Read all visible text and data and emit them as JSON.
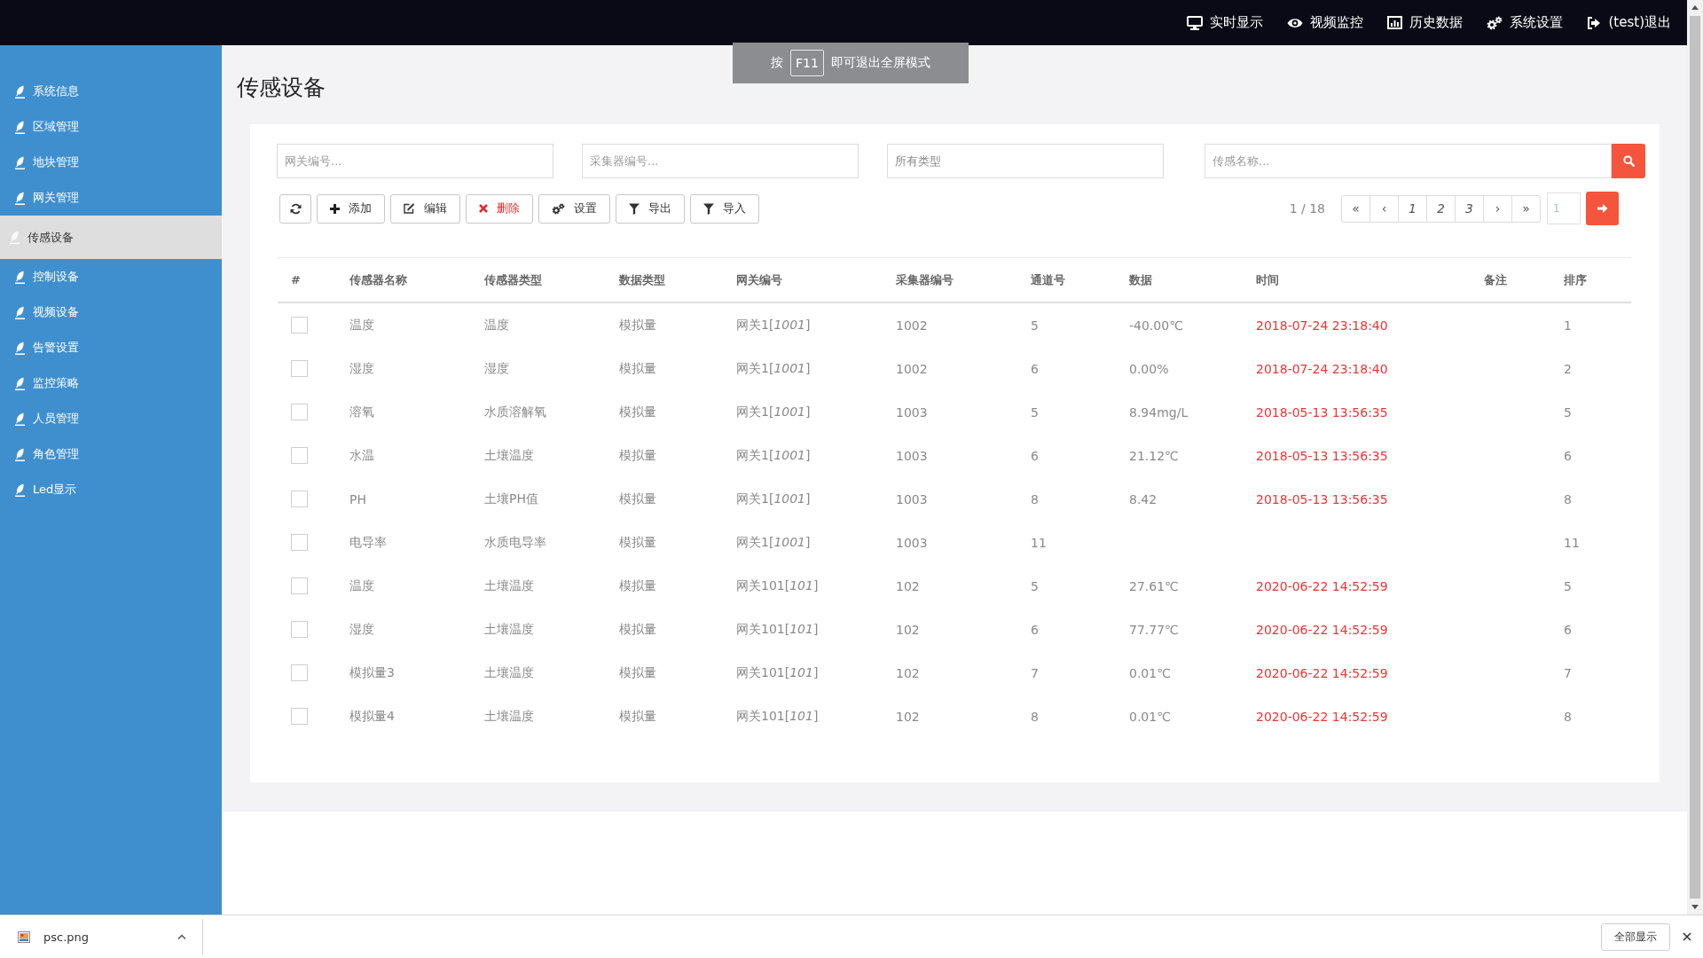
{
  "top_nav": {
    "items": [
      {
        "label": "实时显示"
      },
      {
        "label": "视频监控"
      },
      {
        "label": "历史数据"
      },
      {
        "label": "系统设置"
      },
      {
        "label": "(test)退出"
      }
    ]
  },
  "fullscreen_hint": {
    "before": "按",
    "key": "F11",
    "after": "即可退出全屏模式"
  },
  "sidebar": {
    "items": [
      {
        "label": "系统信息",
        "selected": false
      },
      {
        "label": "区域管理",
        "selected": false
      },
      {
        "label": "地块管理",
        "selected": false
      },
      {
        "label": "网关管理",
        "selected": false
      },
      {
        "label": "传感设备",
        "selected": true
      },
      {
        "label": "控制设备",
        "selected": false
      },
      {
        "label": "视频设备",
        "selected": false
      },
      {
        "label": "告警设置",
        "selected": false
      },
      {
        "label": "监控策略",
        "selected": false
      },
      {
        "label": "人员管理",
        "selected": false
      },
      {
        "label": "角色管理",
        "selected": false
      },
      {
        "label": "Led显示",
        "selected": false
      }
    ]
  },
  "page_title": "传感设备",
  "filters": [
    {
      "kind": "input",
      "placeholder": "网关编号..."
    },
    {
      "kind": "input",
      "placeholder": "采集器编号..."
    },
    {
      "kind": "select",
      "value": "所有类型"
    }
  ],
  "search": {
    "placeholder": "传感名称..."
  },
  "toolbar": {
    "buttons": [
      {
        "label": "添加",
        "kind": "default"
      },
      {
        "label": "编辑",
        "kind": "default"
      },
      {
        "label": "删除",
        "kind": "danger"
      },
      {
        "label": "设置",
        "kind": "default"
      },
      {
        "label": "导出",
        "kind": "default"
      },
      {
        "label": "导入",
        "kind": "default"
      }
    ]
  },
  "pagination": {
    "summary": "1 / 18",
    "buttons": [
      {
        "label": "«",
        "kind": "nav"
      },
      {
        "label": "‹",
        "kind": "nav"
      },
      {
        "label": "1",
        "kind": "page"
      },
      {
        "label": "2",
        "kind": "page"
      },
      {
        "label": "3",
        "kind": "page"
      },
      {
        "label": "›",
        "kind": "nav"
      },
      {
        "label": "»",
        "kind": "nav"
      }
    ],
    "page_input": {
      "placeholder": "1"
    }
  },
  "table": {
    "columns": [
      "#",
      "传感器名称",
      "传感器类型",
      "数据类型",
      "网关编号",
      "采集器编号",
      "通道号",
      "数据",
      "时间",
      "备注",
      "排序"
    ],
    "rows": [
      {
        "checked": false,
        "name": "温度",
        "sensor_type": "温度",
        "data_type": "模拟量",
        "gateway": "网关1[*1001*]",
        "collector": "1002",
        "channel": "5",
        "data": "-40.00℃",
        "time": "2018-07-24 23:18:40",
        "sort": "1"
      },
      {
        "checked": false,
        "name": "湿度",
        "sensor_type": "湿度",
        "data_type": "模拟量",
        "gateway": "网关1[*1001*]",
        "collector": "1002",
        "channel": "6",
        "data": "0.00%",
        "time": "2018-07-24 23:18:40",
        "sort": "2"
      },
      {
        "checked": false,
        "name": "溶氧",
        "sensor_type": "水质溶解氧",
        "data_type": "模拟量",
        "gateway": "网关1[*1001*]",
        "collector": "1003",
        "channel": "5",
        "data": "8.94mg/L",
        "time": "2018-05-13 13:56:35",
        "sort": "5"
      },
      {
        "checked": false,
        "name": "水温",
        "sensor_type": "土壤温度",
        "data_type": "模拟量",
        "gateway": "网关1[*1001*]",
        "collector": "1003",
        "channel": "6",
        "data": "21.12℃",
        "time": "2018-05-13 13:56:35",
        "sort": "6"
      },
      {
        "checked": false,
        "name": "PH",
        "sensor_type": "土壤PH值",
        "data_type": "模拟量",
        "gateway": "网关1[*1001*]",
        "collector": "1003",
        "channel": "8",
        "data": "8.42",
        "time": "2018-05-13 13:56:35",
        "sort": "8"
      },
      {
        "checked": false,
        "name": "电导率",
        "sensor_type": "水质电导率",
        "data_type": "模拟量",
        "gateway": "网关1[*1001*]",
        "collector": "1003",
        "channel": "11",
        "sort": "11"
      },
      {
        "checked": false,
        "name": "温度",
        "sensor_type": "土壤温度",
        "data_type": "模拟量",
        "gateway": "网关101[*101*]",
        "collector": "102",
        "channel": "5",
        "data": "27.61℃",
        "time": "2020-06-22 14:52:59",
        "sort": "5"
      },
      {
        "checked": false,
        "name": "湿度",
        "sensor_type": "土壤温度",
        "data_type": "模拟量",
        "gateway": "网关101[*101*]",
        "collector": "102",
        "channel": "6",
        "data": "77.77℃",
        "time": "2020-06-22 14:52:59",
        "sort": "6"
      },
      {
        "checked": false,
        "name": "模拟量3",
        "sensor_type": "土壤温度",
        "data_type": "模拟量",
        "gateway": "网关101[*101*]",
        "collector": "102",
        "channel": "7",
        "data": "0.01℃",
        "time": "2020-06-22 14:52:59",
        "sort": "7"
      },
      {
        "checked": false,
        "name": "模拟量4",
        "sensor_type": "土壤温度",
        "data_type": "模拟量",
        "gateway": "网关101[*101*]",
        "collector": "102",
        "channel": "8",
        "data": "0.01℃",
        "time": "2020-06-22 14:52:59",
        "sort": "8"
      }
    ]
  },
  "download_bar": {
    "file_name": "psc.png",
    "show_all": "全部显示"
  }
}
